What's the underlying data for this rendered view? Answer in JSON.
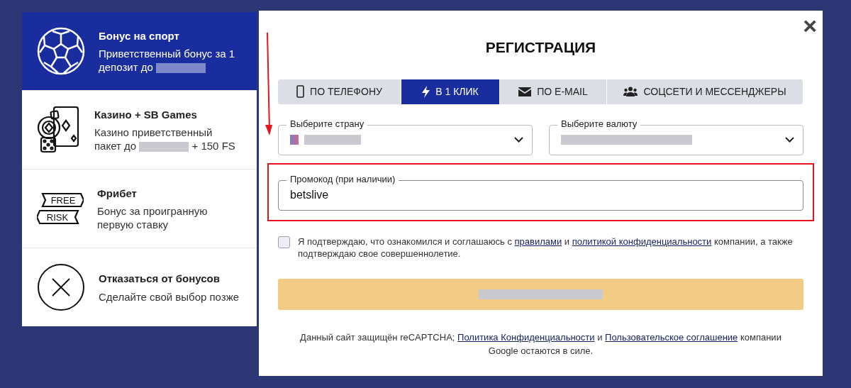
{
  "bonuses": [
    {
      "kind": "ball",
      "title": "Бонус на спорт",
      "description": "Приветственный бонус за 1 депозит до",
      "selected": true
    },
    {
      "kind": "casino",
      "title": "Казино + SB Games",
      "description": "Казино приветственный пакет до",
      "description_end": "+ 150 FS",
      "selected": false
    },
    {
      "kind": "freebet",
      "title": "Фрибет",
      "description": "Бонус за проигранную первую ставку",
      "icon_labels": [
        "FREE",
        "RISK"
      ],
      "selected": false
    },
    {
      "kind": "decline",
      "title": "Отказаться от бонусов",
      "description": "Сделайте свой выбор позже",
      "selected": false
    }
  ],
  "modal": {
    "close": "×",
    "title": "РЕГИСТРАЦИЯ",
    "tabs": [
      {
        "label": "ПО ТЕЛЕФОНУ",
        "selected": false
      },
      {
        "label": "В 1 КЛИК",
        "selected": true
      },
      {
        "label": "ПО E-MAIL",
        "selected": false
      },
      {
        "label": "СОЦСЕТИ И МЕССЕНДЖЕРЫ",
        "selected": false
      }
    ],
    "selects": [
      {
        "label": "Выберите страну"
      },
      {
        "label": "Выберите валюту"
      }
    ],
    "promo": {
      "label": "Промокод (при наличии)",
      "value": "betslive",
      "highlighted": true
    },
    "consent": {
      "checked": false,
      "before": "Я подтверждаю, что ознакомился и соглашаюсь с",
      "link_1": "правилами",
      "middle": "и",
      "link_2": "политикой конфиденциальности",
      "after": "компании, а также подтверждаю свое совершеннолетие."
    },
    "footer": {
      "before": "Данный сайт защищён reCAPTCHA;",
      "link_1": "Политика Конфиденциальности",
      "middle": "и",
      "link_2": "Пользовательское соглашение",
      "after": "компании Google остаются в силе."
    },
    "annotation_arrow": true
  }
}
